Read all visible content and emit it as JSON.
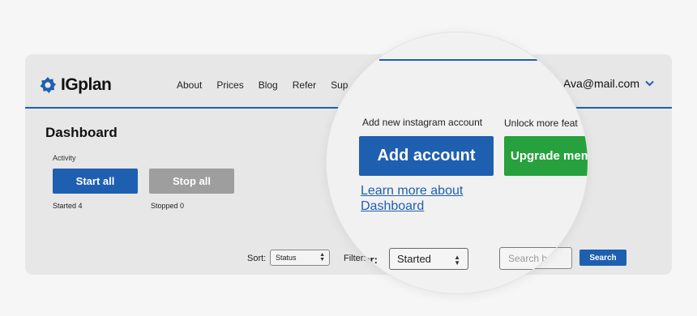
{
  "brand": {
    "name": "IGplan",
    "color": "#1f5fb0"
  },
  "nav": {
    "items": [
      "About",
      "Prices",
      "Blog",
      "Refer",
      "Sup"
    ]
  },
  "user": {
    "email": "Ava@mail.com",
    "menu_icon": "chevron-down-icon"
  },
  "dashboard": {
    "title": "Dashboard",
    "activity_label": "Activity",
    "start_all_label": "Start all",
    "stop_all_label": "Stop all",
    "started_text": "Started 4",
    "stopped_text": "Stopped 0"
  },
  "controls": {
    "sort_label": "Sort:",
    "sort_value": "Status",
    "filter_label": "Filter:",
    "search_button_label": "Search"
  },
  "magnifier": {
    "nav_fragment": "Sup",
    "add_account_caption": "Add new instagram account",
    "add_account_button": "Add account",
    "unlock_caption": "Unlock more feat",
    "upgrade_button": "Upgrade mem",
    "learn_more_link": "Learn more about Dashboard",
    "filter_fragment": "ter:",
    "filter_value": "Started",
    "search_placeholder": "Search b"
  },
  "colors": {
    "primary": "#1f5fb0",
    "upgrade": "#27a13d",
    "disabled": "#9e9e9e"
  }
}
